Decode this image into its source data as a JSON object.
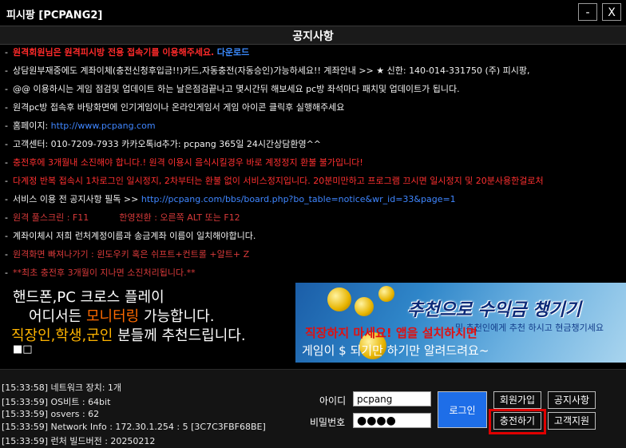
{
  "window": {
    "title": "피시팡 [PCPANG2]",
    "minimize_label": "-",
    "close_label": "X"
  },
  "notice": {
    "title": "공지사항",
    "lines": [
      {
        "dash": "-",
        "text": "원격회원님은 원격피시방 전용 접속기를 이용해주세요.",
        "extra": "다운로드"
      },
      {
        "dash": "-",
        "text": "상담원부재중에도 계좌이체(충전신청후입금!!)카드,자동충전(자동승인)가능하세요!! 계좌안내 >> ★ 신한: 140-014-331750 (주) 피시팡,"
      },
      {
        "dash": "-",
        "text": "@@ 이용하시는 게임 점검및 업데이트 하는 날은점검끝나고 몇시간뒤 해보세요 pc방 좌석마다 패치및 업데이트가 됩니다."
      },
      {
        "dash": "-",
        "text": "원격pc방 접속후 바탕화면에 인기게임이나 온라인게임서 게임 아이콘 클릭후 실행해주세요"
      },
      {
        "dash": "-",
        "text": "홈페이지: ",
        "extra": "http://www.pcpang.com"
      },
      {
        "dash": "-",
        "text": "고객센터: 010-7209-7933 카카오톡id추가: pcpang 365일 24시간상담환영^^"
      },
      {
        "dash": "-",
        "text": "충전후에 3개월내 소진해야 합니다.! 원격 이용시 음식시킬경우 바로 계정정지 환불 불가입니다!"
      },
      {
        "dash": "-",
        "text": "다계정 반복 접속시 1차로그인 일시정지, 2차부터는 환불 없이 서비스정지입니다. 20분미만하고 프로그램 끄시면 일시정지 및 20분사용한걸로처"
      },
      {
        "dash": "-",
        "text": "서비스 이용 전 공지사항 필독 >> ",
        "extra": "http://pcpang.com/bbs/board.php?bo_table=notice&wr_id=33&page=1"
      },
      {
        "dash": "-",
        "text": "원격 풀스크린 : F11",
        "extra": "한영전환 : 오른쪽 ALT 또는 F12"
      },
      {
        "dash": "-",
        "text": "계좌이체시 저희 런처계정이름과 송금계좌 이름이 일치해야합니다."
      },
      {
        "dash": "-",
        "text": "원격화면 빠져나가기 : 윈도우키 혹은 쉬프트+컨트롤 +알트+ Z"
      },
      {
        "dash": "-",
        "text": "**최초 충전후 3개월이 지나면 소진처리됩니다.**"
      }
    ]
  },
  "promo": {
    "line1": "핸드폰,PC 크로스 플레이",
    "line2_a": "어디서든 ",
    "line2_b": "모니터링",
    "line2_c": " 가능합니다.",
    "line3_a": "직장인,학생,군인",
    "line3_b": " 분들께 추천드립니다.",
    "mark": "■□"
  },
  "banner": {
    "title": "추천으로 수익금 챙기기",
    "subtitle": "및 추천인에게 추천 하시고 현금챙기세요",
    "caption1": "직장하지 마세요! 앱을 설치하시면",
    "caption2": "게임이 $ 되기만 하기만 알려드려요~"
  },
  "logs": [
    "[15:33:58] 네트워크 장치: 1개",
    "[15:33:59] OS비트 : 64bit",
    "[15:33:59] osvers : 62",
    "[15:33:59] Network Info : 172.30.1.254 : 5 [3C7C3FBF68BE]",
    "[15:33:59] 런처 빌드버전 : 20250212"
  ],
  "login": {
    "id_label": "아이디",
    "id_value": "pcpang",
    "pw_label": "비밀번호",
    "pw_value": "●●●●",
    "login_button": "로그인",
    "signup_button": "회원가입",
    "notice_button": "공지사항",
    "charge_button": "충전하기",
    "support_button": "고객지원"
  },
  "colors": {
    "accent_blue": "#1e6ee8",
    "highlight_red": "#e00000",
    "notice_red": "#ff3030",
    "link_blue": "#3f86ff"
  }
}
